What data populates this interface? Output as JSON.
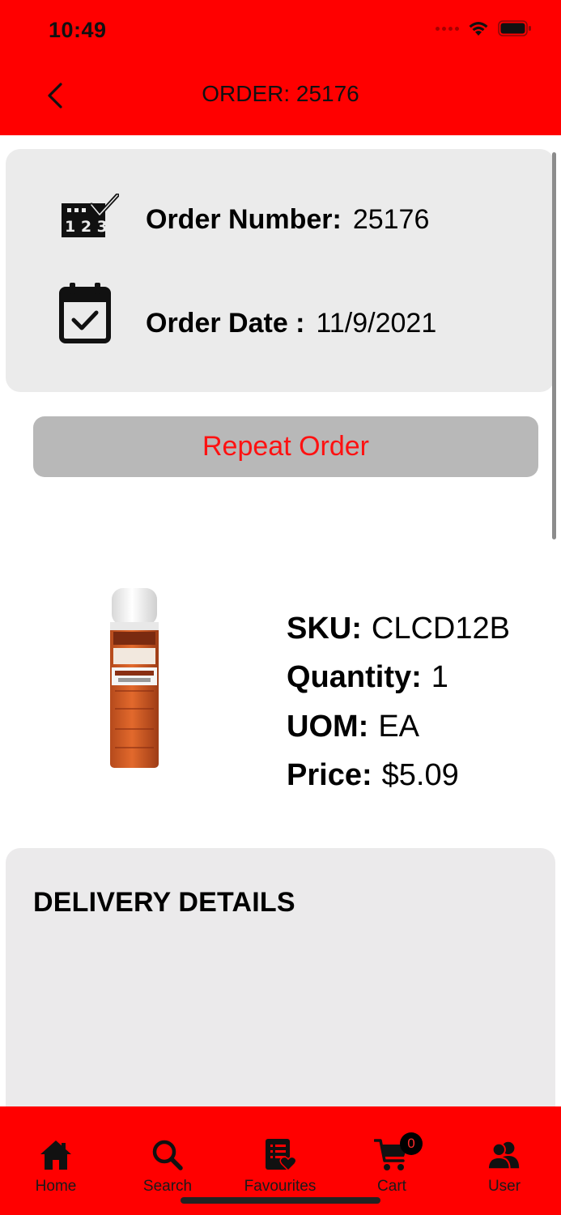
{
  "status_bar": {
    "time": "10:49"
  },
  "nav": {
    "title": "ORDER: 25176"
  },
  "order_info": {
    "number_label": "Order Number:",
    "number_value": "25176",
    "date_label": "Order Date :",
    "date_value": "11/9/2021",
    "number_icon_text": "1 2 3"
  },
  "repeat_button": {
    "label": "Repeat Order"
  },
  "product": {
    "image_icon": "spray-can-icon",
    "sku_label": "SKU:",
    "sku_value": "CLCD12B",
    "quantity_label": "Quantity:",
    "quantity_value": "1",
    "uom_label": "UOM:",
    "uom_value": "EA",
    "price_label": "Price:",
    "price_value": "$5.09"
  },
  "delivery": {
    "title": "DELIVERY DETAILS"
  },
  "tabbar": {
    "items": [
      {
        "label": "Home",
        "icon": "home-icon"
      },
      {
        "label": "Search",
        "icon": "search-icon"
      },
      {
        "label": "Favourites",
        "icon": "favourites-list-icon"
      },
      {
        "label": "Cart",
        "icon": "cart-icon"
      },
      {
        "label": "User",
        "icon": "users-icon"
      }
    ],
    "cart_count": "0"
  },
  "colors": {
    "brand_red": "#ff0000",
    "card_gray": "#ebebeb",
    "button_gray": "#b8b8b8",
    "button_text": "#ff1111"
  }
}
